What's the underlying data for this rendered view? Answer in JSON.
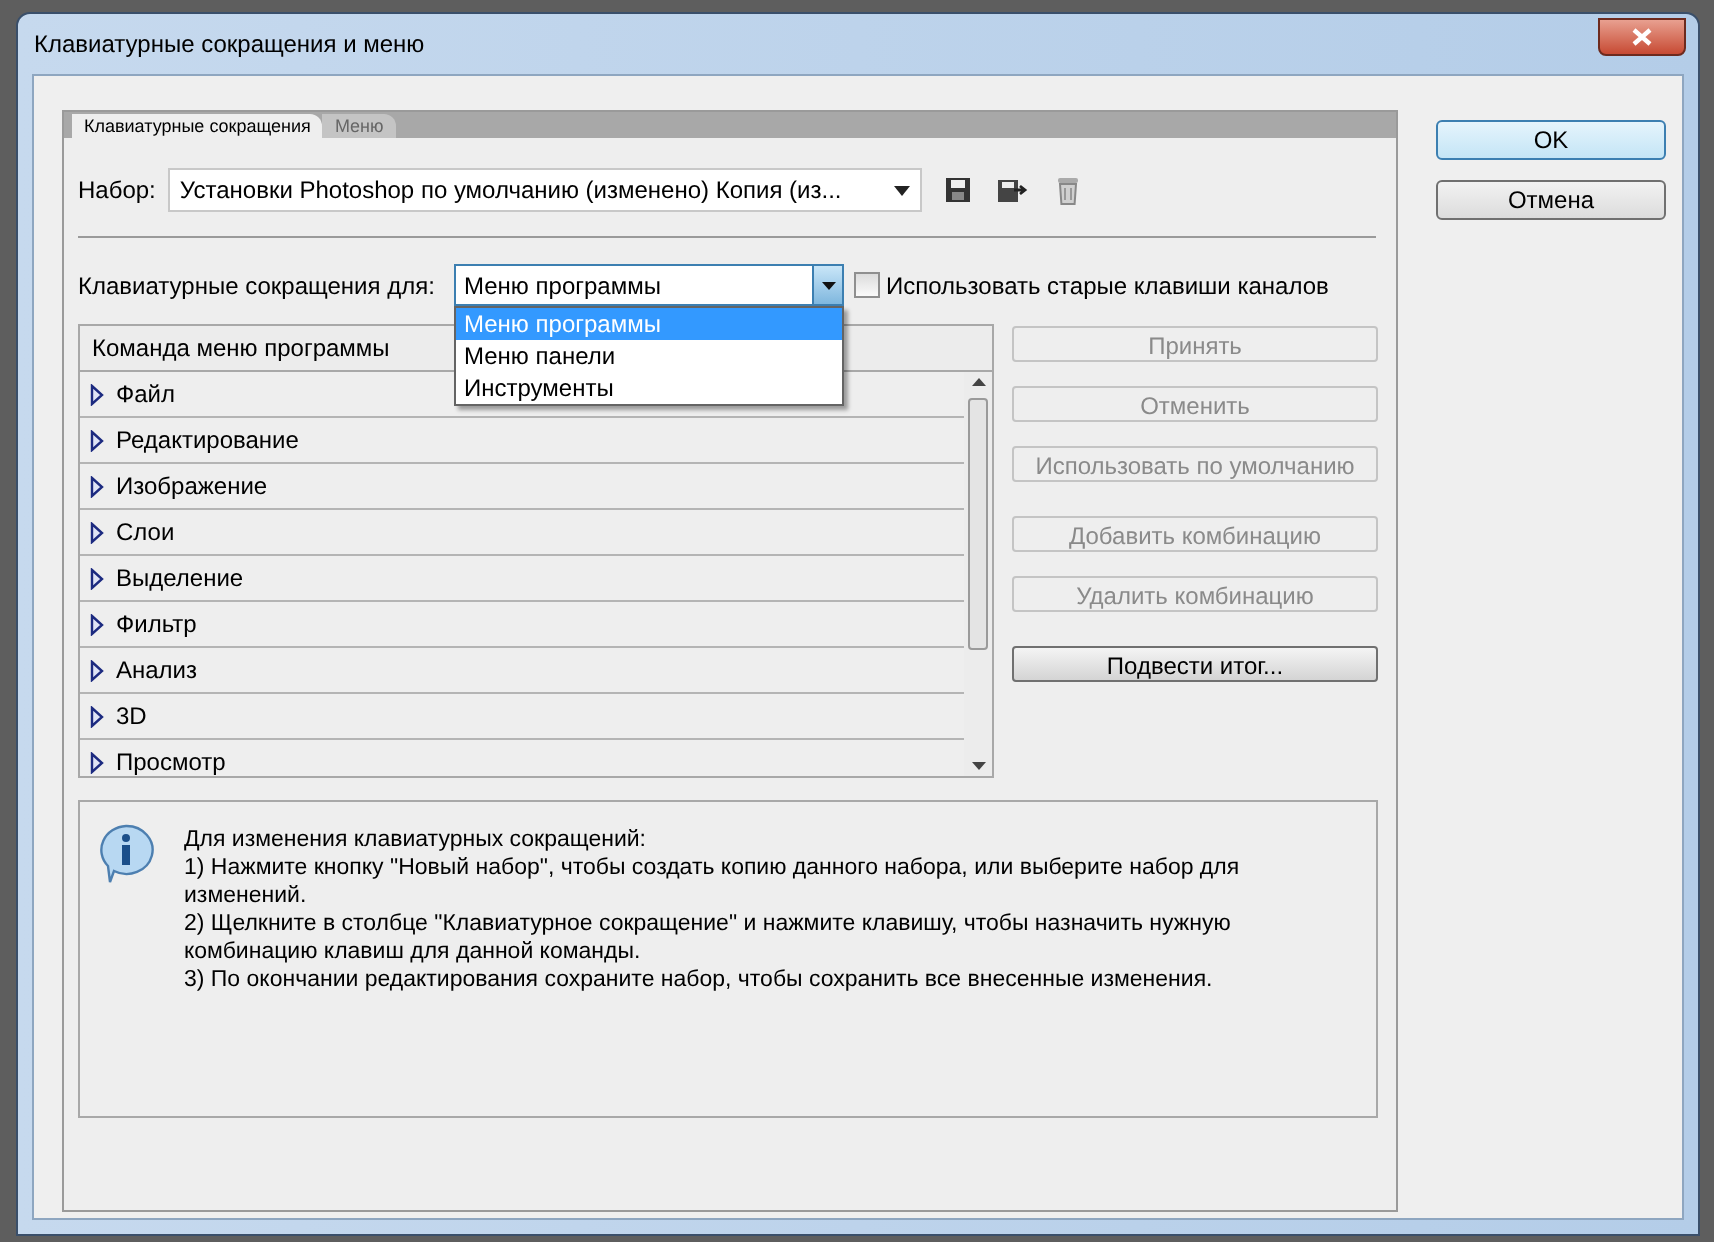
{
  "window": {
    "title": "Клавиатурные сокращения и меню"
  },
  "dialog_buttons": [
    {
      "label": "OK",
      "default": true
    },
    {
      "label": "Отмена",
      "default": false
    }
  ],
  "tabs": [
    {
      "label": "Клавиатурные сокращения",
      "selected": true
    },
    {
      "label": "Меню",
      "selected": false
    }
  ],
  "set": {
    "label": "Набор:",
    "value": "Установки Photoshop по умолчанию (изменено) Копия (из..."
  },
  "shortcuts_for": {
    "label": "Клавиатурные сокращения для:",
    "value": "Меню программы",
    "expanded": true,
    "options": [
      {
        "label": "Меню программы",
        "selected": true
      },
      {
        "label": "Меню панели",
        "selected": false
      },
      {
        "label": "Инструменты",
        "selected": false
      }
    ]
  },
  "legacy_checkbox": {
    "label": "Использовать старые клавиши каналов",
    "checked": false
  },
  "table": {
    "columns": [
      "Команда меню программы"
    ],
    "rows": [
      {
        "label": "Файл",
        "expanded": false
      },
      {
        "label": "Редактирование",
        "expanded": false
      },
      {
        "label": "Изображение",
        "expanded": false
      },
      {
        "label": "Слои",
        "expanded": false
      },
      {
        "label": "Выделение",
        "expanded": false
      },
      {
        "label": "Фильтр",
        "expanded": false
      },
      {
        "label": "Анализ",
        "expanded": false
      },
      {
        "label": "3D",
        "expanded": false
      },
      {
        "label": "Просмотр",
        "expanded": false
      }
    ]
  },
  "action_buttons": [
    {
      "label": "Принять",
      "disabled": true
    },
    {
      "label": "Отменить",
      "disabled": true
    },
    {
      "label": "Использовать по умолчанию",
      "disabled": true
    },
    {
      "label": "Добавить комбинацию",
      "disabled": true
    },
    {
      "label": "Удалить комбинацию",
      "disabled": true
    },
    {
      "label": "Подвести итог...",
      "disabled": false
    }
  ],
  "info": {
    "lines": [
      "Для изменения клавиатурных сокращений:",
      "1) Нажмите кнопку \"Новый набор\", чтобы создать копию данного набора, или выберите набор для изменений.",
      "2) Щелкните в столбце \"Клавиатурное сокращение\" и нажмите клавишу, чтобы назначить нужную комбинацию клавиш для данной команды.",
      "3) По окончании редактирования сохраните набор, чтобы сохранить все внесенные изменения."
    ]
  }
}
